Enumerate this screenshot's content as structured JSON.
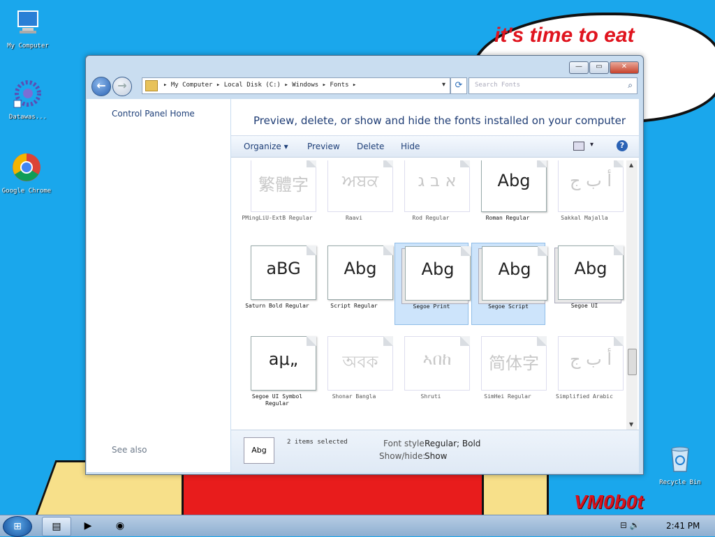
{
  "wallpaper": {
    "speech_bubble": "it's time to eat",
    "logo": "VM0b0t"
  },
  "desktop_icons": [
    {
      "name": "computer",
      "label": "My Computer"
    },
    {
      "name": "datawaas",
      "label": "Datawas..."
    },
    {
      "name": "chrome",
      "label": "Google Chrome"
    },
    {
      "name": "recycle-bin",
      "label": "Recycle Bin"
    }
  ],
  "window": {
    "address_path": "▸ My Computer ▸ Local Disk (C:) ▸ Windows ▸ Fonts ▸",
    "search_placeholder": "Search Fonts",
    "sidebar": {
      "home_link": "Control Panel Home",
      "see_also": "See also"
    },
    "heading": "Preview, delete, or show and hide the fonts installed on your computer",
    "commands": {
      "organize": "Organize ▾",
      "preview": "Preview",
      "delete": "Delete",
      "hide": "Hide"
    },
    "fonts": [
      {
        "sample": "繁體字",
        "label": "PMingLiU-ExtB Regular",
        "hidden": true,
        "stack": false,
        "selected": false
      },
      {
        "sample": "ਅਬਕ",
        "label": "Raavi",
        "hidden": true,
        "stack": true,
        "selected": false
      },
      {
        "sample": "א ב ג",
        "label": "Rod Regular",
        "hidden": true,
        "stack": false,
        "selected": false
      },
      {
        "sample": "Abg",
        "label": "Roman Regular",
        "hidden": false,
        "stack": false,
        "selected": false
      },
      {
        "sample": "أ ب ج",
        "label": "Sakkal Majalla",
        "hidden": true,
        "stack": true,
        "selected": false
      },
      {
        "sample": "aBG",
        "label": "Saturn Bold Regular",
        "hidden": false,
        "stack": false,
        "selected": false
      },
      {
        "sample": "Abg",
        "label": "Script Regular",
        "hidden": false,
        "stack": false,
        "selected": false
      },
      {
        "sample": "Abg",
        "label": "Segoe Print",
        "hidden": false,
        "stack": true,
        "selected": true
      },
      {
        "sample": "Abg",
        "label": "Segoe Script",
        "hidden": false,
        "stack": true,
        "selected": true
      },
      {
        "sample": "Abg",
        "label": "Segoe UI",
        "hidden": false,
        "stack": true,
        "selected": false
      },
      {
        "sample": "aμ„",
        "label": "Segoe UI Symbol Regular",
        "hidden": false,
        "stack": false,
        "selected": false
      },
      {
        "sample": "অবক",
        "label": "Shonar Bangla",
        "hidden": true,
        "stack": true,
        "selected": false
      },
      {
        "sample": "ኣበከ",
        "label": "Shruti",
        "hidden": true,
        "stack": true,
        "selected": false
      },
      {
        "sample": "简体字",
        "label": "SimHei Regular",
        "hidden": true,
        "stack": false,
        "selected": false
      },
      {
        "sample": "أ ب ج",
        "label": "Simplified Arabic",
        "hidden": true,
        "stack": true,
        "selected": false
      }
    ],
    "details": {
      "icon_sample": "Abg",
      "selection": "2 items selected",
      "font_style_key": "Font style:",
      "font_style_val": "Regular; Bold",
      "show_hide_key": "Show/hide:",
      "show_hide_val": "Show"
    }
  },
  "taskbar": {
    "clock": "2:41 PM"
  }
}
